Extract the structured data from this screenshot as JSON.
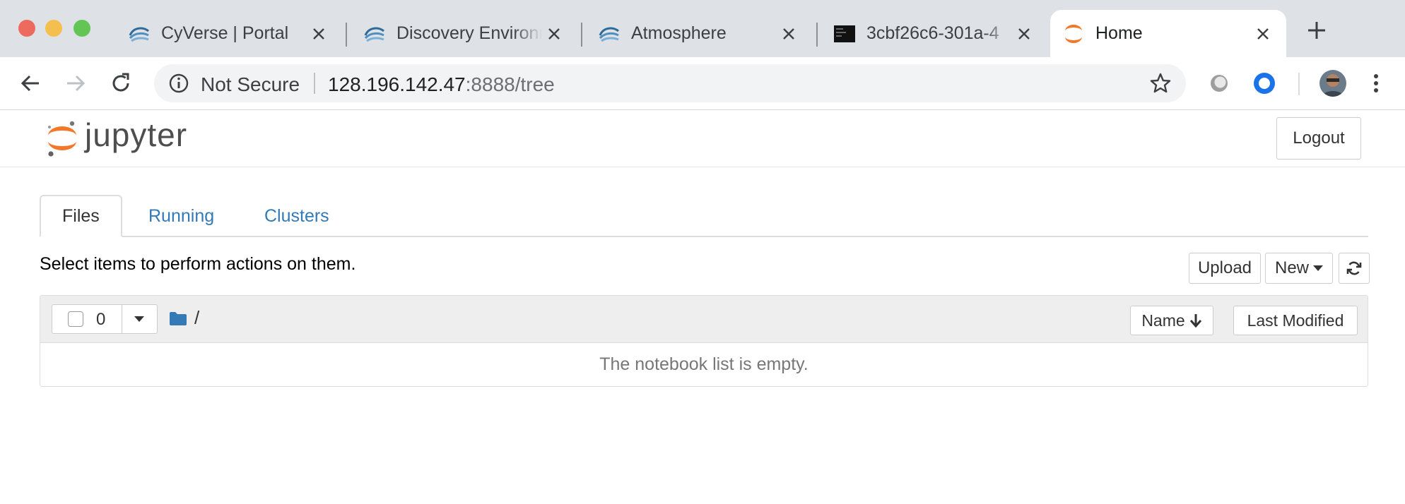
{
  "browser": {
    "tabs": [
      {
        "title": "CyVerse | Portal",
        "favicon": "cyverse-logo-icon"
      },
      {
        "title": "Discovery Environment",
        "favicon": "cyverse-logo-icon"
      },
      {
        "title": "Atmosphere",
        "favicon": "cyverse-logo-icon"
      },
      {
        "title": "3cbf26c6-301a-4",
        "favicon": "terminal-icon"
      },
      {
        "title": "Home",
        "favicon": "jupyter-logo-icon",
        "active": true
      }
    ],
    "address": {
      "security": "Not Secure",
      "host": "128.196.142.47",
      "path": ":8888/tree"
    }
  },
  "page": {
    "logo_text": "jupyter",
    "logout_label": "Logout",
    "tabs": [
      "Files",
      "Running",
      "Clusters"
    ],
    "instructions": "Select items to perform actions on them.",
    "toolbar": {
      "upload_label": "Upload",
      "new_label": "New",
      "refresh_icon": "refresh-icon"
    },
    "list": {
      "selected_count": "0",
      "breadcrumb": "/",
      "sort_name_label": "Name",
      "sort_modified_label": "Last Modified",
      "empty_message": "The notebook list is empty."
    }
  },
  "colors": {
    "link": "#337ab7",
    "jupyter_orange": "#f37726",
    "tabstrip": "#dee1e6",
    "extension_blue": "#1a73e8"
  }
}
